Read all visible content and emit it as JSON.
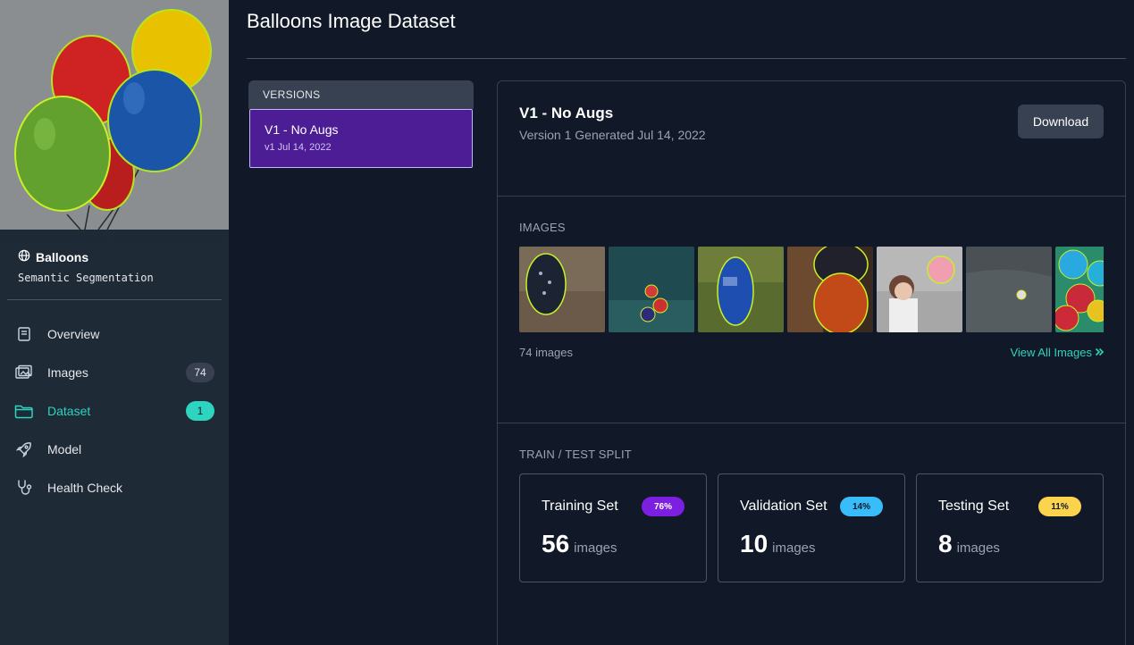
{
  "project": {
    "name": "Balloons",
    "type": "Semantic Segmentation"
  },
  "nav": [
    {
      "label": "Overview",
      "icon": "book-icon"
    },
    {
      "label": "Images",
      "icon": "images-icon",
      "badge": "74"
    },
    {
      "label": "Dataset",
      "icon": "folder-icon",
      "badge": "1",
      "active": true
    },
    {
      "label": "Model",
      "icon": "rocket-icon"
    },
    {
      "label": "Health Check",
      "icon": "stethoscope-icon"
    }
  ],
  "page": {
    "title": "Balloons Image Dataset"
  },
  "versions": {
    "header": "VERSIONS",
    "items": [
      {
        "name": "V1 - No Augs",
        "date": "v1 Jul 14, 2022"
      }
    ]
  },
  "detail": {
    "title": "V1 - No Augs",
    "subtitle": "Version 1 Generated Jul 14, 2022",
    "download_label": "Download",
    "images_label": "IMAGES",
    "image_count": "74 images",
    "view_all": "View All Images",
    "split_label": "TRAIN / TEST SPLIT",
    "splits": [
      {
        "name": "Training Set",
        "percent": "76%",
        "count": "56",
        "unit": "images",
        "color": "#7c1fe0",
        "text_color": "#ffffff"
      },
      {
        "name": "Validation Set",
        "percent": "14%",
        "count": "10",
        "unit": "images",
        "color": "#38bdf8",
        "text_color": "#0f172a"
      },
      {
        "name": "Testing Set",
        "percent": "11%",
        "count": "8",
        "unit": "images",
        "color": "#fcd34d",
        "text_color": "#0f172a"
      }
    ]
  },
  "colors": {
    "accent": "#2dd4bf",
    "version_selected": "#4c1d95",
    "background": "#111827"
  }
}
